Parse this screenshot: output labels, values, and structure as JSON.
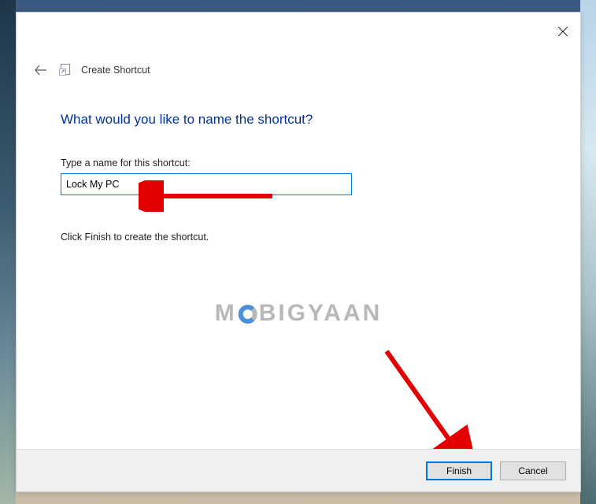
{
  "header": {
    "title": "Create Shortcut"
  },
  "content": {
    "question": "What would you like to name the shortcut?",
    "label": "Type a name for this shortcut:",
    "input_value": "Lock My PC",
    "instruction": "Click Finish to create the shortcut."
  },
  "footer": {
    "finish_label": "Finish",
    "cancel_label": "Cancel"
  },
  "watermark": {
    "prefix": "M",
    "suffix": "BIGYAAN"
  }
}
